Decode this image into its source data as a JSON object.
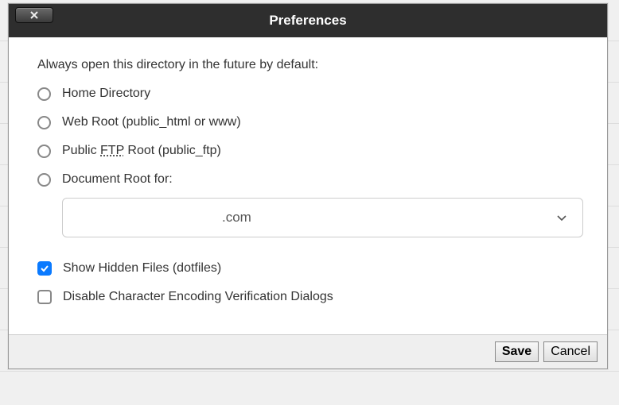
{
  "dialog": {
    "title": "Preferences",
    "prompt": "Always open this directory in the future by default:",
    "radios": [
      {
        "label": "Home Directory"
      },
      {
        "label_pre": "Web Root (public_html or www)"
      },
      {
        "label_pre": "Public ",
        "abbr": "FTP",
        "label_post": " Root (public_ftp)"
      },
      {
        "label_pre": "Document Root for:"
      }
    ],
    "select_value": ".com",
    "checkboxes": [
      {
        "label": "Show Hidden Files (dotfiles)",
        "checked": true
      },
      {
        "label": "Disable Character Encoding Verification Dialogs",
        "checked": false
      }
    ],
    "buttons": {
      "save": "Save",
      "cancel": "Cancel"
    }
  }
}
